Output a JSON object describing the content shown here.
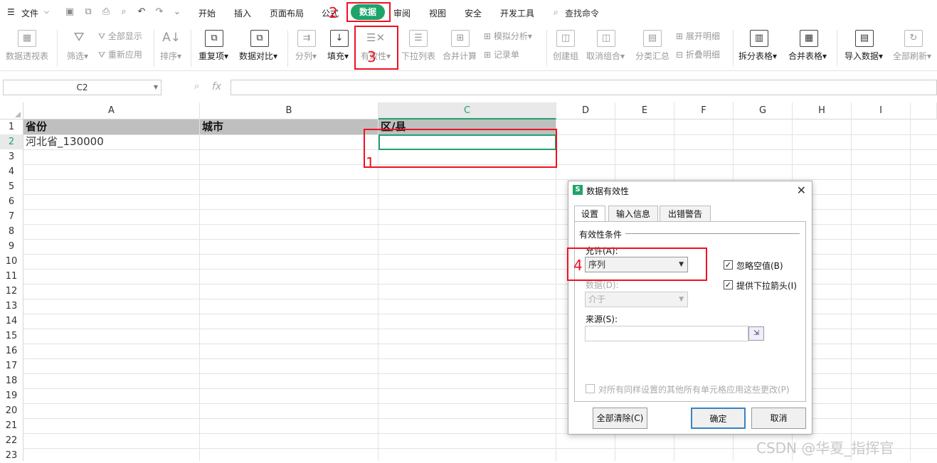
{
  "menubar": {
    "file_label": "文件",
    "tabs": [
      "开始",
      "插入",
      "页面布局",
      "公式",
      "数据",
      "审阅",
      "视图",
      "安全",
      "开发工具"
    ],
    "search_label": "查找命令"
  },
  "ribbon": {
    "pivot": "数据透视表",
    "filter": "筛选",
    "show_all": "全部显示",
    "reapply": "重新应用",
    "sort": "排序",
    "duplicates": "重复项",
    "compare": "数据对比",
    "split_col": "分列",
    "fill": "填充",
    "validity": "有效性",
    "dropdown": "下拉列表",
    "consolidate": "合并计算",
    "simulate": "模拟分析",
    "record": "记录单",
    "group": "创建组",
    "ungroup": "取消组合",
    "subtotal": "分类汇总",
    "expand": "展开明细",
    "collapse": "折叠明细",
    "split_table": "拆分表格",
    "merge_table": "合并表格",
    "import": "导入数据",
    "refresh_all": "全部刷新"
  },
  "formula_bar": {
    "name_box": "C2",
    "fx": "fx"
  },
  "sheet": {
    "columns": [
      "A",
      "B",
      "C",
      "D",
      "E",
      "F",
      "G",
      "H",
      "I"
    ],
    "rows": [
      "1",
      "2",
      "3",
      "4",
      "5",
      "6",
      "7",
      "8",
      "9",
      "10",
      "11",
      "12",
      "13",
      "14",
      "15",
      "16",
      "17",
      "18",
      "19",
      "20",
      "21",
      "22",
      "23"
    ],
    "a1": "省份",
    "b1": "城市",
    "c1": "区/县",
    "a2": "河北省_130000"
  },
  "dialog": {
    "title": "数据有效性",
    "tabs": [
      "设置",
      "输入信息",
      "出错警告"
    ],
    "section": "有效性条件",
    "allow_label": "允许(A):",
    "allow_value": "序列",
    "data_label": "数据(D):",
    "data_value": "介于",
    "ignore_blank": "忽略空值(B)",
    "in_cell_dropdown": "提供下拉箭头(I)",
    "source_label": "来源(S):",
    "source_value": "",
    "apply_all": "对所有同样设置的其他所有单元格应用这些更改(P)",
    "clear_all": "全部清除(C)",
    "ok": "确定",
    "cancel": "取消"
  },
  "annotations": [
    "1",
    "2",
    "3",
    "4"
  ],
  "watermark": "CSDN @华夏_指挥官",
  "colors": {
    "accent": "#1fa36b",
    "annotation": "#ee1122"
  }
}
